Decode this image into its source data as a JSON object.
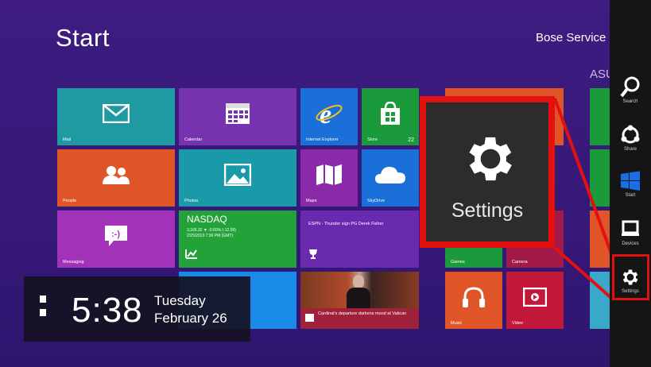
{
  "start": {
    "title": "Start",
    "user": "Bose Service",
    "group_label": "ASU"
  },
  "tiles": {
    "mail": {
      "label": "Mail",
      "icon": "mail-icon"
    },
    "calendar": {
      "label": "Calendar",
      "icon": "calendar-icon"
    },
    "internet_explorer": {
      "label": "Internet Explorer",
      "icon": "internet-explorer-icon"
    },
    "store": {
      "label": "Store",
      "badge": "22",
      "icon": "store-icon"
    },
    "people": {
      "label": "People",
      "icon": "people-icon"
    },
    "photos": {
      "label": "Photos",
      "icon": "photos-icon"
    },
    "maps": {
      "label": "Maps",
      "icon": "maps-icon"
    },
    "skydrive": {
      "label": "SkyDrive",
      "icon": "cloud-icon"
    },
    "messaging": {
      "label": "Messaging",
      "icon": "messaging-icon"
    },
    "finance": {
      "title": "NASDAQ",
      "line1": "3,165.32  ▼  -0.60% (-12.59)",
      "line2": "2/25/2013 7:36 PM (GMT)",
      "icon": "chart-icon"
    },
    "sports": {
      "headline": "ESPN - Thunder sign PG Derek Fisher",
      "icon": "trophy-icon"
    },
    "news": {
      "headline": "Cardinal's departure darkens mood at Vatican",
      "icon": "news-icon"
    },
    "games": {
      "label": "Games",
      "icon": "games-icon"
    },
    "camera": {
      "label": "Camera",
      "icon": "camera-icon"
    },
    "music": {
      "label": "Music",
      "icon": "headphones-icon"
    },
    "video": {
      "label": "Video",
      "icon": "video-icon"
    }
  },
  "lock_clock": {
    "time": "5:38",
    "day": "Tuesday",
    "date": "February 26"
  },
  "callout": {
    "label": "Settings",
    "icon": "gear-icon"
  },
  "charms": [
    {
      "label": "Search",
      "icon": "search-icon"
    },
    {
      "label": "Share",
      "icon": "share-icon"
    },
    {
      "label": "Start",
      "icon": "windows-logo-icon"
    },
    {
      "label": "Devices",
      "icon": "devices-icon"
    },
    {
      "label": "Settings",
      "icon": "gear-icon"
    }
  ],
  "colors": {
    "background": "#3a1a7a",
    "highlight": "#e31010",
    "charms_bar": "#151515"
  }
}
